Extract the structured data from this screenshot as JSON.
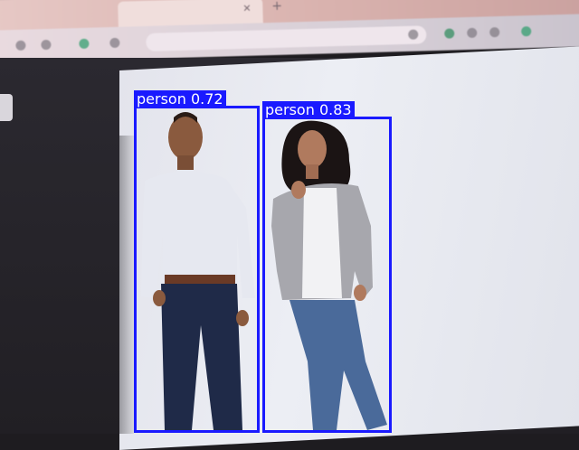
{
  "browser": {
    "tab_title": "",
    "address": ""
  },
  "detections": [
    {
      "label": "person",
      "score": "0.72",
      "color": "#1a1aff"
    },
    {
      "label": "person",
      "score": "0.83",
      "color": "#1a1aff"
    }
  ],
  "colors": {
    "box": "#1a1aff",
    "label_text": "#ffffff"
  }
}
